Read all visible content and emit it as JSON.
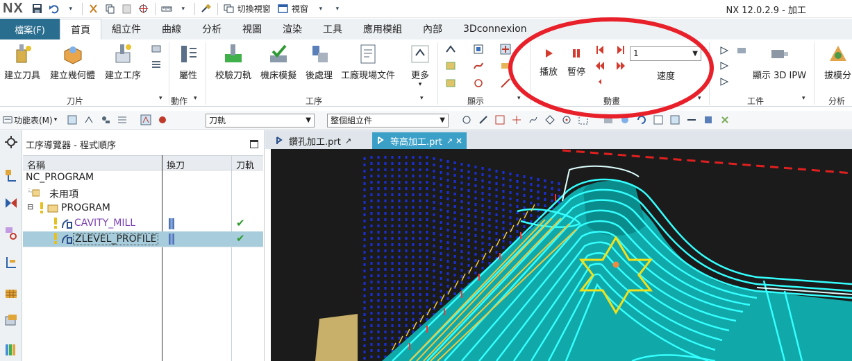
{
  "titlebar": {
    "logo": "NX",
    "switch_view": "切換視窗",
    "window": "視窗",
    "app_title": "NX 12.0.2.9 - 加工"
  },
  "menu": {
    "file": "檔案(F)",
    "tabs": [
      "首頁",
      "組立件",
      "曲線",
      "分析",
      "視圖",
      "渲染",
      "工具",
      "應用模組",
      "內部",
      "3Dconnexion"
    ]
  },
  "ribbon": {
    "create_tool": "建立刀具",
    "create_geometry": "建立幾何體",
    "create_operation": "建立工序",
    "group_insert": "刀片",
    "properties": "屬性",
    "group_action": "動作",
    "verify_toolpath": "校驗刀軌",
    "machine_sim": "機床模擬",
    "postprocess": "後處理",
    "shop_doc": "工廠現場文件",
    "more": "更多",
    "group_operation": "工序",
    "group_display": "顯示",
    "play": "播放",
    "pause": "暫停",
    "speed_value": "1",
    "speed": "速度",
    "group_animation": "動畫",
    "show_3d_ipw": "顯示 3D IPW",
    "group_workpiece": "工件",
    "draft_analysis": "拔模分",
    "group_analysis": "分析"
  },
  "toolbar2": {
    "menu": "功能表(M)",
    "toolpath_combo": "刀軌",
    "assembly_combo": "整個組立件"
  },
  "navigator": {
    "title": "工序導覽器 - 程式順序",
    "columns": [
      "名稱",
      "換刀",
      "刀軌"
    ],
    "rows": [
      {
        "name": "NC_PROGRAM"
      },
      {
        "name": "未用項"
      },
      {
        "name": "PROGRAM"
      },
      {
        "name": "CAVITY_MILL"
      },
      {
        "name": "ZLEVEL_PROFILE"
      }
    ]
  },
  "doctabs": [
    "鑽孔加工.prt",
    "等高加工.prt"
  ]
}
